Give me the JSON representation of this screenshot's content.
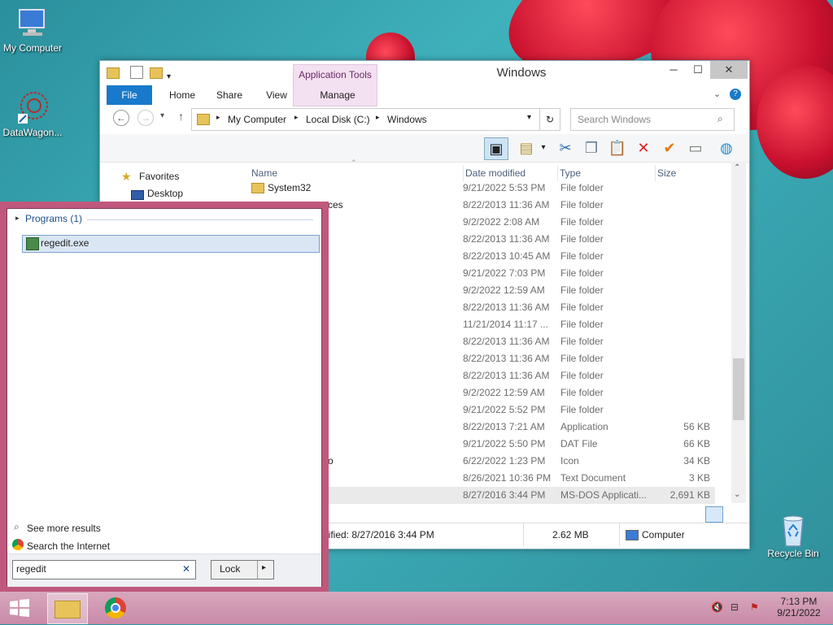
{
  "desktop": {
    "icons": [
      {
        "label": "My Computer",
        "icon": "computer-icon"
      },
      {
        "label": "DataWagon...",
        "icon": "datawagon-icon"
      },
      {
        "label": "Recycle Bin",
        "icon": "recycle-bin-icon"
      }
    ]
  },
  "window": {
    "title": "Windows",
    "ribbon": {
      "tabs": [
        "File",
        "Home",
        "Share",
        "View",
        "Manage"
      ],
      "contextual_group": "Application Tools"
    },
    "address": {
      "crumbs": [
        "My Computer",
        "Local Disk (C:)",
        "Windows"
      ],
      "search_placeholder": "Search Windows"
    },
    "nav": {
      "favorites": "Favorites",
      "desktop": "Desktop"
    },
    "columns": [
      "Name",
      "Date modified",
      "Type",
      "Size"
    ],
    "rows": [
      {
        "name": "System32",
        "date": "9/21/2022 5:53 PM",
        "type": "File folder",
        "size": ""
      },
      {
        "name": "ces",
        "date": "8/22/2013 11:36 AM",
        "type": "File folder",
        "size": ""
      },
      {
        "name": "",
        "date": "9/2/2022 2:08 AM",
        "type": "File folder",
        "size": ""
      },
      {
        "name": "",
        "date": "8/22/2013 11:36 AM",
        "type": "File folder",
        "size": ""
      },
      {
        "name": "",
        "date": "8/22/2013 10:45 AM",
        "type": "File folder",
        "size": ""
      },
      {
        "name": "",
        "date": "9/21/2022 7:03 PM",
        "type": "File folder",
        "size": ""
      },
      {
        "name": "",
        "date": "9/2/2022 12:59 AM",
        "type": "File folder",
        "size": ""
      },
      {
        "name": "",
        "date": "8/22/2013 11:36 AM",
        "type": "File folder",
        "size": ""
      },
      {
        "name": "",
        "date": "11/21/2014 11:17 ...",
        "type": "File folder",
        "size": ""
      },
      {
        "name": "",
        "date": "8/22/2013 11:36 AM",
        "type": "File folder",
        "size": ""
      },
      {
        "name": "",
        "date": "8/22/2013 11:36 AM",
        "type": "File folder",
        "size": ""
      },
      {
        "name": "",
        "date": "8/22/2013 11:36 AM",
        "type": "File folder",
        "size": ""
      },
      {
        "name": "",
        "date": "9/2/2022 12:59 AM",
        "type": "File folder",
        "size": ""
      },
      {
        "name": "",
        "date": "9/21/2022 5:52 PM",
        "type": "File folder",
        "size": ""
      },
      {
        "name": "",
        "date": "8/22/2013 7:21 AM",
        "type": "Application",
        "size": "56 KB"
      },
      {
        "name": "",
        "date": "9/21/2022 5:50 PM",
        "type": "DAT File",
        "size": "66 KB"
      },
      {
        "name": "o",
        "date": "6/22/2022 1:23 PM",
        "type": "Icon",
        "size": "34 KB"
      },
      {
        "name": "",
        "date": "8/26/2021 10:36 PM",
        "type": "Text Document",
        "size": "3 KB"
      },
      {
        "name": "",
        "date": "8/27/2016 3:44 PM",
        "type": "MS-DOS Applicati...",
        "size": "2,691 KB"
      }
    ],
    "status": {
      "modified": "lified: 8/27/2016 3:44 PM",
      "size": "2.62 MB",
      "location": "Computer"
    }
  },
  "start_search": {
    "group_label": "Programs (1)",
    "result": "regedit.exe",
    "see_more": "See more results",
    "search_internet": "Search the Internet",
    "query": "regedit",
    "lock_label": "Lock"
  },
  "taskbar": {
    "time": "7:13 PM",
    "date": "9/21/2022"
  }
}
